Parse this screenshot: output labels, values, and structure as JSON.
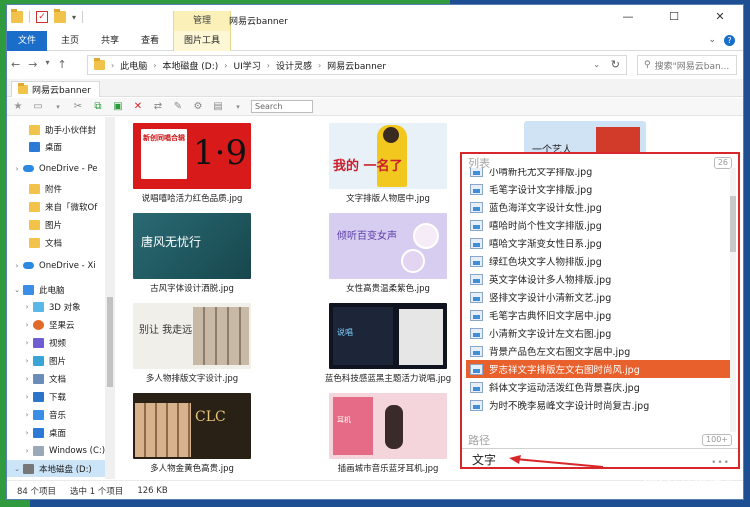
{
  "window": {
    "title": "网易云banner",
    "manage_tab": "管理",
    "controls": [
      "—",
      "☐",
      "✕"
    ]
  },
  "ribbon": {
    "tabs": [
      "文件",
      "主页",
      "共享",
      "查看",
      "图片工具"
    ],
    "help": "?"
  },
  "address": {
    "crumbs": [
      "此电脑",
      "本地磁盘 (D:)",
      "UI学习",
      "设计灵感",
      "网易云banner"
    ],
    "search_placeholder": "搜索\"网易云ban..."
  },
  "folder_tab": {
    "label": "网易云banner"
  },
  "toolbar2": {
    "search_placeholder": "Search"
  },
  "sidebar": {
    "items": [
      {
        "label": "助手小伙伴封",
        "icon": "folder-icon"
      },
      {
        "label": "桌面",
        "icon": "desktop-icon"
      },
      {
        "label": "OneDrive - Pe",
        "icon": "onedrive-icon"
      },
      {
        "label": "附件",
        "icon": "folder-icon"
      },
      {
        "label": "来自「微软Of",
        "icon": "folder-icon"
      },
      {
        "label": "图片",
        "icon": "folder-icon"
      },
      {
        "label": "文档",
        "icon": "folder-icon"
      },
      {
        "label": "OneDrive - Xi",
        "icon": "onedrive-icon"
      },
      {
        "label": "此电脑",
        "icon": "pc-icon"
      },
      {
        "label": "3D 对象",
        "icon": "3d-icon"
      },
      {
        "label": "坚果云",
        "icon": "jianguoyun-icon"
      },
      {
        "label": "视频",
        "icon": "video-icon"
      },
      {
        "label": "图片",
        "icon": "pictures-icon"
      },
      {
        "label": "文档",
        "icon": "documents-icon"
      },
      {
        "label": "下载",
        "icon": "downloads-icon"
      },
      {
        "label": "音乐",
        "icon": "music-icon"
      },
      {
        "label": "桌面",
        "icon": "desktop-icon"
      },
      {
        "label": "Windows (C:)",
        "icon": "drive-icon"
      },
      {
        "label": "本地磁盘 (D:)",
        "icon": "drive-icon"
      }
    ]
  },
  "files": [
    {
      "caption": "说唱嘻哈活力红色品质.jpg",
      "poster": "新创同唱合辑"
    },
    {
      "caption": "文字排版人物居中.jpg",
      "poster": "我的 一名了"
    },
    {
      "caption": "",
      "poster": "一个艺人"
    },
    {
      "caption": "古风字体设计洒脱.jpg",
      "poster": "唐风无忧行"
    },
    {
      "caption": "女性高贵温柔紫色.jpg",
      "poster": "倾听百变女声"
    },
    {
      "caption": "多人物排版文字设计.jpg",
      "poster": "别让 我走远"
    },
    {
      "caption": "蓝色科技感蓝黑主题活力说唱.jpg",
      "poster": "说唱"
    },
    {
      "caption": "多人物金黄色高贵.jpg",
      "poster": "CLC"
    },
    {
      "caption": "插画城市音乐蓝牙耳机.jpg",
      "poster": "耳机"
    }
  ],
  "status": {
    "count": "84 个项目",
    "selected": "选中 1 个项目",
    "size": "126 KB"
  },
  "popup": {
    "list_title": "列表",
    "list_count": "26",
    "path_title": "路径",
    "path_count": "100+",
    "query": "文字",
    "dots": "•••",
    "items": [
      "小啃新托尤文字排版.jpg",
      "毛笔字设计文字排版.jpg",
      "蓝色海洋文字设计女性.jpg",
      "嘻哈时尚个性文字排版.jpg",
      "嘻哈文字渐变女性日系.jpg",
      "绿红色块文字人物排版.jpg",
      "英文字体设计多人物排版.jpg",
      "竖排文字设计小清新文艺.jpg",
      "毛笔字古典怀旧文字居中.jpg",
      "小清新文字设计左文右图.jpg",
      "背景产品色左文右图文字居中.jpg",
      "罗志祥文字排版左文右图时尚风.jpg",
      "斜体文字运动活泼红色背景喜庆.jpg",
      "为时不晚李易峰文字设计时尚复古.jpg"
    ],
    "highlight_index": 11
  },
  "watermark": {
    "text": "什么值得买",
    "icon": "值"
  }
}
